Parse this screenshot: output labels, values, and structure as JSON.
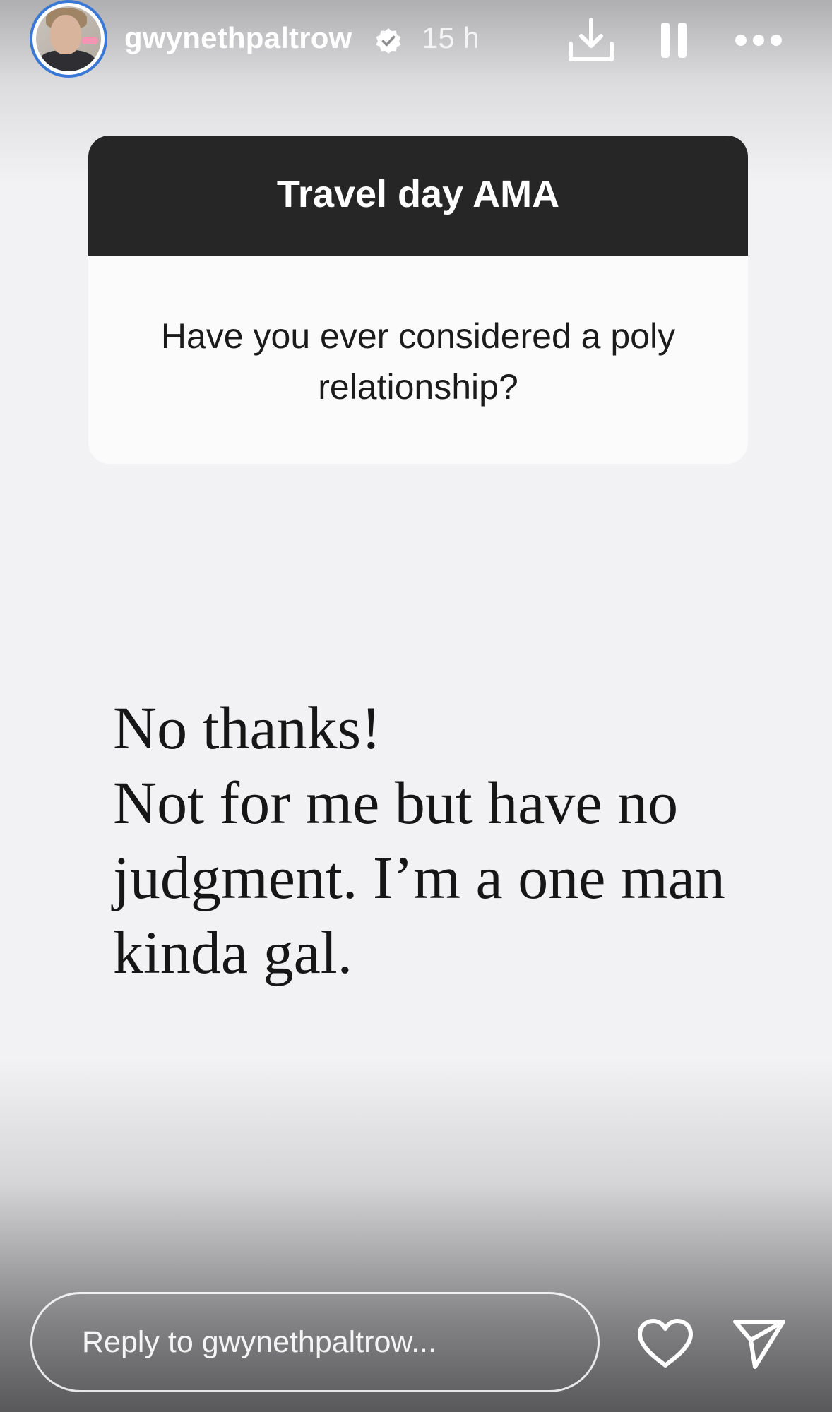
{
  "header": {
    "username": "gwynethpaltrow",
    "timestamp": "15 h",
    "icons": [
      "verified-badge-icon",
      "download-icon",
      "pause-icon",
      "more-icon"
    ]
  },
  "question_card": {
    "title": "Travel day AMA",
    "question": "Have you ever considered a poly relationship?"
  },
  "answer": {
    "text": "No thanks!\nNot for me but have no judgment. I’m a one man kinda gal."
  },
  "reply": {
    "placeholder": "Reply to gwynethpaltrow...",
    "value": ""
  },
  "actions": {
    "icons": [
      "heart-icon",
      "send-icon"
    ]
  },
  "colors": {
    "background": "#f2f1f3",
    "card_header": "#262626",
    "avatar_ring": "#3a78d6",
    "text_dark": "#161616"
  }
}
